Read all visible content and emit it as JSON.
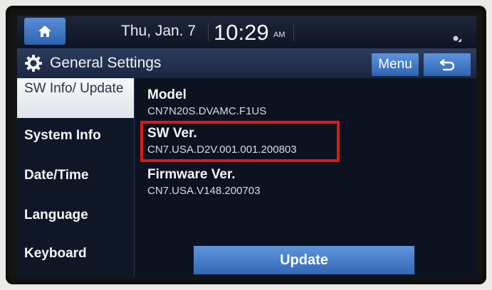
{
  "status": {
    "date": "Thu, Jan. 7",
    "time": "10:29",
    "ampm": "AM"
  },
  "header": {
    "title": "General Settings",
    "menu_label": "Menu"
  },
  "sidebar": {
    "items": [
      {
        "label": "SW Info/ Update",
        "active": true
      },
      {
        "label": "System Info",
        "active": false
      },
      {
        "label": "Date/Time",
        "active": false
      },
      {
        "label": "Language",
        "active": false
      },
      {
        "label": "Keyboard",
        "active": false
      }
    ]
  },
  "info": {
    "model_label": "Model",
    "model_value": "CN7N20S.DVAMC.F1US",
    "sw_label": "SW Ver.",
    "sw_value": "CN7.USA.D2V.001.001.200803",
    "firmware_label": "Firmware Ver.",
    "firmware_value": "CN7.USA.V148.200703"
  },
  "actions": {
    "update_label": "Update"
  },
  "colors": {
    "accent": "#3367b5",
    "highlight": "#e2161b",
    "background": "#0d1220"
  }
}
